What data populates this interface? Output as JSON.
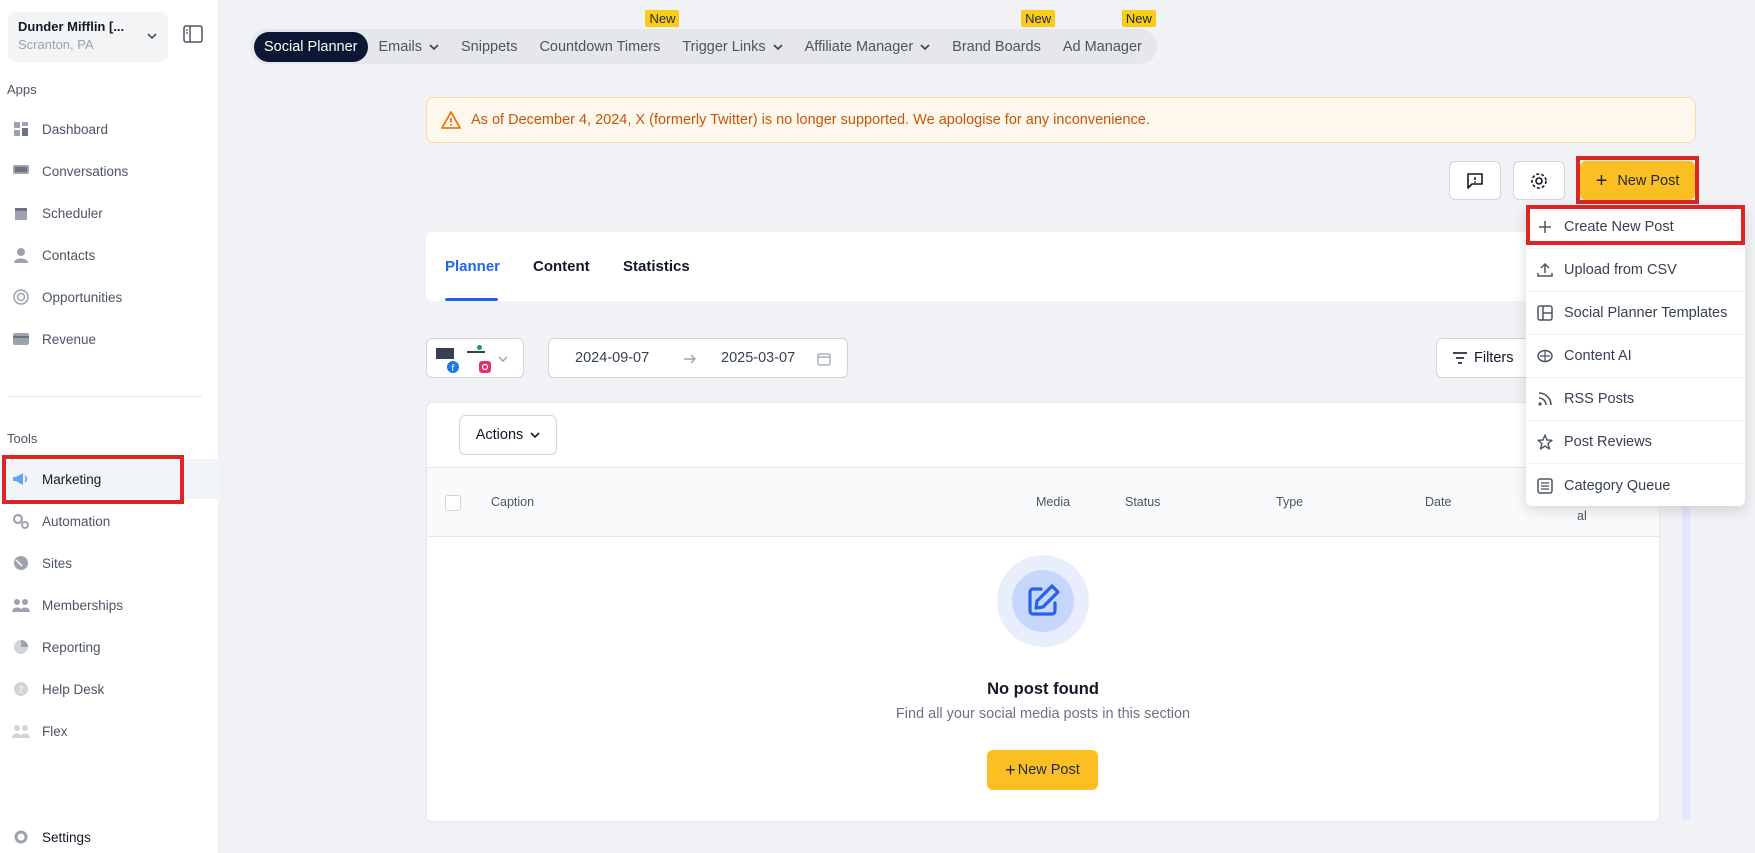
{
  "location": {
    "name": "Dunder Mifflin [...",
    "sub": "Scranton, PA"
  },
  "sidebar": {
    "apps_label": "Apps",
    "tools_label": "Tools",
    "apps": [
      {
        "label": "Dashboard",
        "icon": "dashboard-icon"
      },
      {
        "label": "Conversations",
        "icon": "chat-icon"
      },
      {
        "label": "Scheduler",
        "icon": "calendar-icon"
      },
      {
        "label": "Contacts",
        "icon": "user-icon"
      },
      {
        "label": "Opportunities",
        "icon": "target-icon"
      },
      {
        "label": "Revenue",
        "icon": "card-icon"
      }
    ],
    "tools": [
      {
        "label": "Marketing",
        "icon": "megaphone-icon"
      },
      {
        "label": "Automation",
        "icon": "gears-icon"
      },
      {
        "label": "Sites",
        "icon": "globe-icon"
      },
      {
        "label": "Memberships",
        "icon": "users-icon"
      },
      {
        "label": "Reporting",
        "icon": "pie-icon"
      },
      {
        "label": "Help Desk",
        "icon": "help-icon"
      },
      {
        "label": "Flex",
        "icon": "users-icon"
      }
    ],
    "settings_label": "Settings"
  },
  "topnav": {
    "tabs": [
      {
        "label": "Social Planner"
      },
      {
        "label": "Emails"
      },
      {
        "label": "Snippets"
      },
      {
        "label": "Countdown Timers",
        "badge": "New"
      },
      {
        "label": "Trigger Links"
      },
      {
        "label": "Affiliate Manager"
      },
      {
        "label": "Brand Boards",
        "badge": "New"
      },
      {
        "label": "Ad Manager",
        "badge": "New"
      }
    ]
  },
  "alert": {
    "text": "As of December 4, 2024, X (formerly Twitter) is no longer supported. We apologise for any inconvenience."
  },
  "toolbar": {
    "new_post_label": "New Post"
  },
  "planner_tabs": [
    "Planner",
    "Content",
    "Statistics"
  ],
  "date_range": {
    "start": "2024-09-07",
    "end": "2025-03-07"
  },
  "filters_label": "Filters",
  "actions_label": "Actions",
  "table": {
    "columns": [
      "Caption",
      "Media",
      "Status",
      "Type",
      "Date"
    ],
    "partial_col": "al"
  },
  "empty_state": {
    "title": "No post found",
    "subtitle": "Find all your social media posts in this section",
    "button": "New Post"
  },
  "dropdown": {
    "items": [
      {
        "label": "Create New Post",
        "icon": "plus-icon"
      },
      {
        "label": "Upload from CSV",
        "icon": "upload-icon"
      },
      {
        "label": "Social Planner Templates",
        "icon": "template-icon"
      },
      {
        "label": "Content AI",
        "icon": "brain-icon"
      },
      {
        "label": "RSS Posts",
        "icon": "rss-icon"
      },
      {
        "label": "Post Reviews",
        "icon": "star-icon"
      },
      {
        "label": "Category Queue",
        "icon": "queue-icon"
      }
    ]
  },
  "colors": {
    "accent": "#fbbf24",
    "highlight": "#dc2626",
    "primary": "#2563eb",
    "nav_active": "#0b1733"
  }
}
